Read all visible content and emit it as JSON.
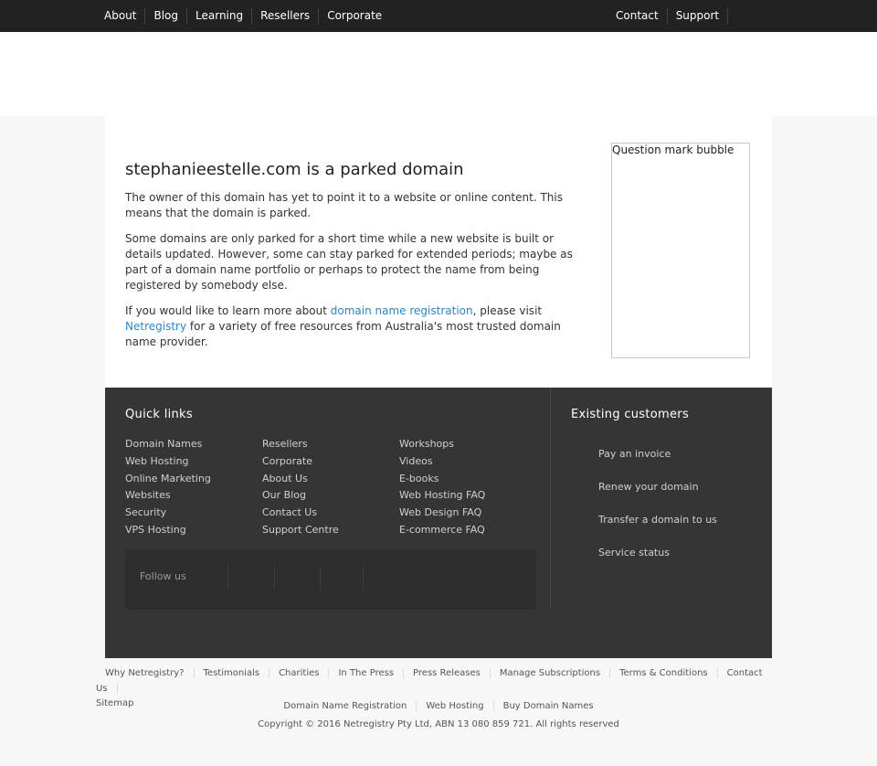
{
  "topnav": {
    "left": [
      "About",
      "Blog",
      "Learning",
      "Resellers",
      "Corporate"
    ],
    "right": [
      "Contact",
      "Support"
    ]
  },
  "main": {
    "title": "stephanieestelle.com is a parked domain",
    "p1": "The owner of this domain has yet to point it to a website or online content. This means that the domain is parked.",
    "p2": "Some domains are only parked for a short time while a new website is built or details updated. However, some can stay parked for extended periods; maybe as part of a domain name portfolio or perhaps to protect the name from being registered by somebody else.",
    "p3_before": "If you would like to learn more about ",
    "p3_link1": "domain name registration",
    "p3_mid": ", please visit ",
    "p3_link2": "Netregistry",
    "p3_after": " for a variety of free resources from Australia's most trusted domain name provider.",
    "bubble_alt": "Question mark bubble"
  },
  "quicklinks": {
    "title": "Quick links",
    "col1": [
      "Domain Names",
      "Web Hosting",
      "Online Marketing",
      "Websites",
      "Security",
      "VPS Hosting"
    ],
    "col2": [
      "Resellers",
      "Corporate",
      "About Us",
      "Our Blog",
      "Contact Us",
      "Support Centre"
    ],
    "col3": [
      "Workshops",
      "Videos",
      "E-books",
      "Web Hosting FAQ",
      "Web Design FAQ",
      "E-commerce FAQ"
    ],
    "follow": "Follow us"
  },
  "existing": {
    "title": "Existing customers",
    "links": [
      "Pay an invoice",
      "Renew your domain",
      "Transfer a domain to us",
      "Service status"
    ]
  },
  "bottom_links": [
    "Why Netregistry?",
    "Testimonials",
    "Charities",
    "In The Press",
    "Press Releases",
    "Manage Subscriptions",
    "Terms & Conditions",
    "Contact Us",
    "Sitemap"
  ],
  "seo_links": [
    "Domain Name Registration",
    "Web Hosting",
    "Buy Domain Names"
  ],
  "copyright": "Copyright © 2016 Netregistry Pty Ltd, ABN 13 080 859 721. All rights reserved"
}
